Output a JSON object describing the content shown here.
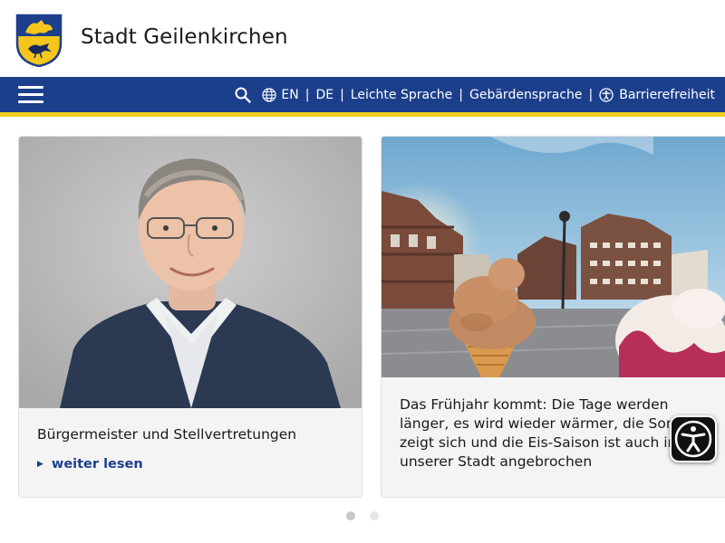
{
  "site": {
    "title": "Stadt Geilenkirchen"
  },
  "nav": {
    "languages": [
      "EN",
      "DE"
    ],
    "links": [
      "Leichte Sprache",
      "Gebärdensprache",
      "Barrierefreiheit"
    ],
    "separator": "|"
  },
  "cards": [
    {
      "title": "Bürgermeister und Stellvertretungen",
      "read_more": "weiter lesen"
    },
    {
      "text": "Das Frühjahr kommt: Die Tage werden länger, es wird wieder wärmer, die Sonne zeigt sich und die Eis-Saison ist auch in unserer Stadt angebrochen"
    }
  ],
  "icons": {
    "menu": "hamburger-menu-icon",
    "search": "search-icon",
    "globe": "globe-icon",
    "accessibility": "accessibility-icon",
    "read_more": "caret-right-icon",
    "widget": "accessibility-widget-icon"
  },
  "colors": {
    "nav_bg": "#1c3f8c",
    "nav_stripe": "#f0cf1c",
    "link": "#1c3f8c"
  },
  "carousel": {
    "active_index": 0,
    "count": 2
  }
}
